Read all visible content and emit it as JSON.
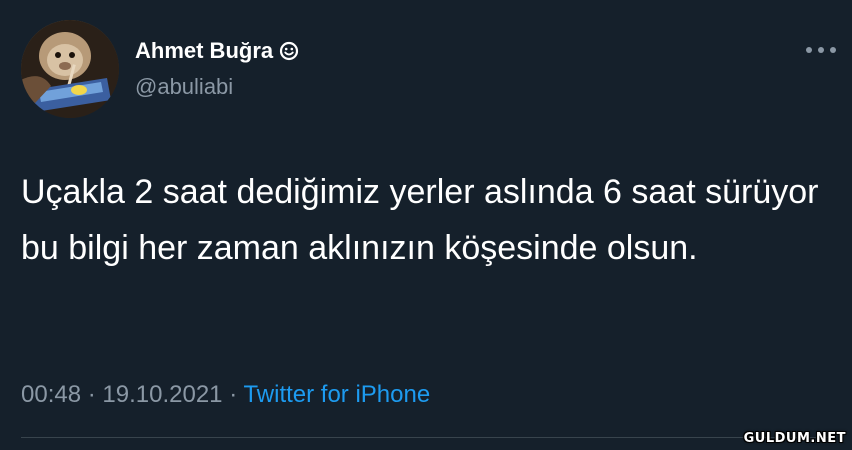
{
  "author": {
    "display_name": "Ahmet Buğra",
    "handle": "@abuliabi",
    "name_emoji_icon": "smiley-face-icon"
  },
  "tweet": {
    "text": "Uçakla 2 saat dediğimiz yerler aslında 6 saat sürüyor bu bilgi her zaman aklınızın köşesinde olsun.",
    "time": "00:48",
    "separator": "·",
    "date": "19.10.2021",
    "source": "Twitter for iPhone"
  },
  "menu": {
    "icon": "more-options-icon"
  },
  "watermark": {
    "text": "GULDUM.NET"
  },
  "colors": {
    "background": "#15202b",
    "text_primary": "#ffffff",
    "text_secondary": "#8b98a5",
    "link": "#1d9bf0",
    "divider": "#38444d"
  }
}
